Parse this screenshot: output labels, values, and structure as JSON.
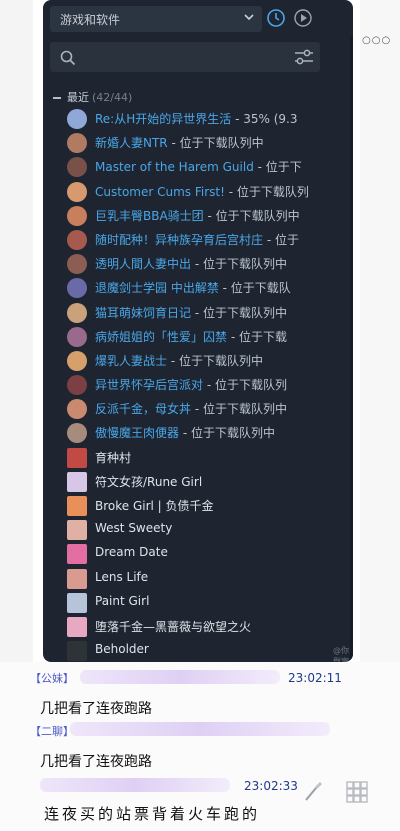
{
  "library": {
    "filter_select": "游戏和软件",
    "search": {
      "placeholder": ""
    },
    "section": {
      "label": "最近",
      "count": "(42/44)"
    },
    "items": [
      {
        "title": "Re:从H开始的异世界生活",
        "status": " - 35% (9.3",
        "style": "blue",
        "avatar_color": "#8fa8d8"
      },
      {
        "title": "新婚人妻NTR",
        "status": " - 位于下载队列中",
        "style": "blue",
        "avatar_color": "#b07b62"
      },
      {
        "title": "Master of the Harem Guild",
        "status": " - 位于下",
        "style": "blue",
        "avatar_color": "#7a5148"
      },
      {
        "title": "Customer Cums First!",
        "status": " - 位于下载队列",
        "style": "blue",
        "avatar_color": "#d79a6f"
      },
      {
        "title": "巨乳丰臀BBA骑士团",
        "status": " - 位于下载队列中",
        "style": "blue",
        "avatar_color": "#c77f5d"
      },
      {
        "title": "随时配种！异种族孕育后宫村庄",
        "status": " - 位于",
        "style": "blue",
        "avatar_color": "#a55a4d"
      },
      {
        "title": "透明人間人妻中出",
        "status": " - 位于下载队列中",
        "style": "blue",
        "avatar_color": "#8c5d52"
      },
      {
        "title": "退魔剑士学园 中出解禁",
        "status": " - 位于下载队",
        "style": "blue",
        "avatar_color": "#6b6aa8"
      },
      {
        "title": "猫耳萌妹饲育日记",
        "status": " - 位于下载队列中",
        "style": "blue",
        "avatar_color": "#c9a27c"
      },
      {
        "title": "病娇姐姐的「性爱」囚禁",
        "status": " - 位于下载",
        "style": "blue",
        "avatar_color": "#9a6a8c"
      },
      {
        "title": "爆乳人妻战士",
        "status": " - 位于下载队列中",
        "style": "blue",
        "avatar_color": "#d5a06b"
      },
      {
        "title": "异世界怀孕后宫派对",
        "status": " - 位于下载队列",
        "style": "blue",
        "avatar_color": "#7b3f44"
      },
      {
        "title": "反派千金，母女丼",
        "status": " - 位于下载队列中",
        "style": "blue",
        "avatar_color": "#c98a70"
      },
      {
        "title": "傲慢魔王肉便器",
        "status": " - 位于下载队列中",
        "style": "blue",
        "avatar_color": "#a78c7e"
      },
      {
        "title": "育种村",
        "status": "",
        "style": "white",
        "avatar_color": "#c24a44"
      },
      {
        "title": "符文女孩/Rune Girl",
        "status": "",
        "style": "white",
        "avatar_color": "#d7c6e6"
      },
      {
        "title": "Broke Girl | 负债千金",
        "status": "",
        "style": "white",
        "avatar_color": "#e98f5a"
      },
      {
        "title": "West Sweety",
        "status": "",
        "style": "white",
        "avatar_color": "#e1b0a4"
      },
      {
        "title": "Dream Date",
        "status": "",
        "style": "white",
        "avatar_color": "#e36fa2"
      },
      {
        "title": "Lens Life",
        "status": "",
        "style": "white",
        "avatar_color": "#d99a90"
      },
      {
        "title": "Paint Girl",
        "status": "",
        "style": "white",
        "avatar_color": "#b7c3d8"
      },
      {
        "title": "堕落千金—黑蔷薇与欲望之火",
        "status": "",
        "style": "white",
        "avatar_color": "#e7a8c2"
      },
      {
        "title": "Beholder",
        "status": "",
        "style": "white",
        "avatar_color": "#2e3338"
      }
    ],
    "watermark": "@你群寓岛",
    "accent_color": "#4aa6e8"
  },
  "chat": {
    "messages": [
      {
        "fragment": "【公妹】",
        "time": "23:02:11",
        "text": "几把看了连夜跑路"
      },
      {
        "fragment": "【二聊】",
        "time": "",
        "text": "几把看了连夜跑路"
      },
      {
        "fragment": "",
        "time": "23:02:33",
        "text": "连夜买的站票背着火车跑的"
      }
    ]
  }
}
